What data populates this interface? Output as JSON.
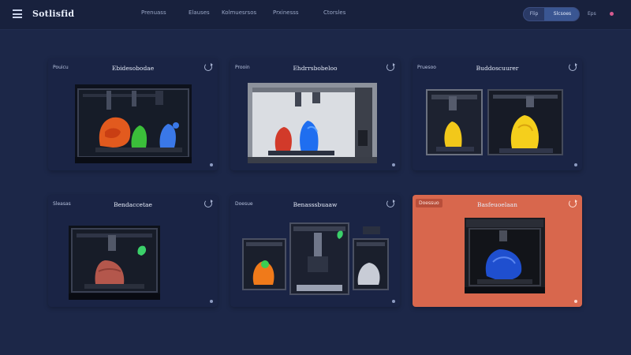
{
  "header": {
    "brand": "Sotlisfid",
    "nav": [
      "Prenuass",
      "Elauses",
      "Kolmuesrsos",
      "Prxinesss",
      "Ctorsles"
    ],
    "search": {
      "left_label": "Flip",
      "right_label": "Slcsoes"
    },
    "lang_label": "Eps"
  },
  "cards": [
    {
      "tag": "Pouicu",
      "title": "Ebidesobodae",
      "active": false
    },
    {
      "tag": "Prooin",
      "title": "Ehdrrsbobeloo",
      "active": false
    },
    {
      "tag": "Pruesoo",
      "title": "Buddoscuurer",
      "active": false
    },
    {
      "tag": "Sleasas",
      "title": "Bendaccetae",
      "active": false
    },
    {
      "tag": "Doesue",
      "title": "Benasssbuaaw",
      "active": false
    },
    {
      "tag": "Doessuo",
      "title": "Basfeuoelaan",
      "active": true
    }
  ],
  "colors": {
    "background": "#1c2748",
    "card": "#1a2445",
    "accent": "#d8674d",
    "search_accent": "#3a5692"
  },
  "icons": [
    "menu-icon",
    "refresh-icon",
    "user-icon"
  ]
}
